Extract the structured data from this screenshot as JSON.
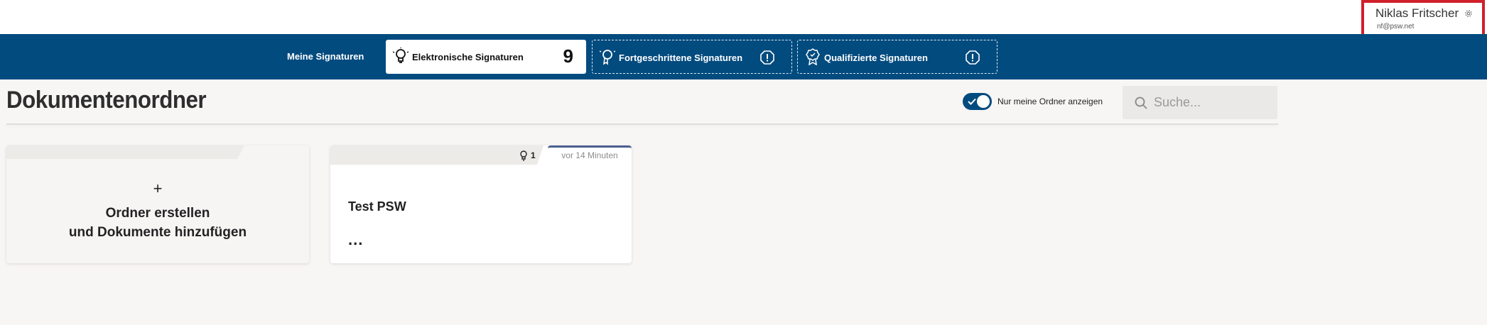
{
  "user": {
    "name": "Niklas Fritscher",
    "email": "nf@psw.net"
  },
  "nav": {
    "label": "Meine Signaturen",
    "tabs": [
      {
        "label": "Elektronische Signaturen",
        "count": "9",
        "active": true
      },
      {
        "label": "Fortgeschrittene Signaturen",
        "icon": "alert-icon"
      },
      {
        "label": "Qualifizierte Signaturen",
        "icon": "alert-icon"
      }
    ]
  },
  "page": {
    "title": "Dokumentenordner",
    "toggle_label": "Nur meine Ordner anzeigen",
    "toggle_on": true,
    "search_placeholder": "Suche..."
  },
  "cards": {
    "new_folder": {
      "plus": "+",
      "line1": "Ordner erstellen",
      "line2": "und Dokumente hinzufügen"
    },
    "folder": {
      "signature_count": "1",
      "time": "vor 14 Minuten",
      "title": "Test PSW",
      "menu": "..."
    }
  },
  "colors": {
    "nav_bg": "#024b7f",
    "highlight_border": "#d0202a",
    "page_bg": "#f8f5f5"
  }
}
